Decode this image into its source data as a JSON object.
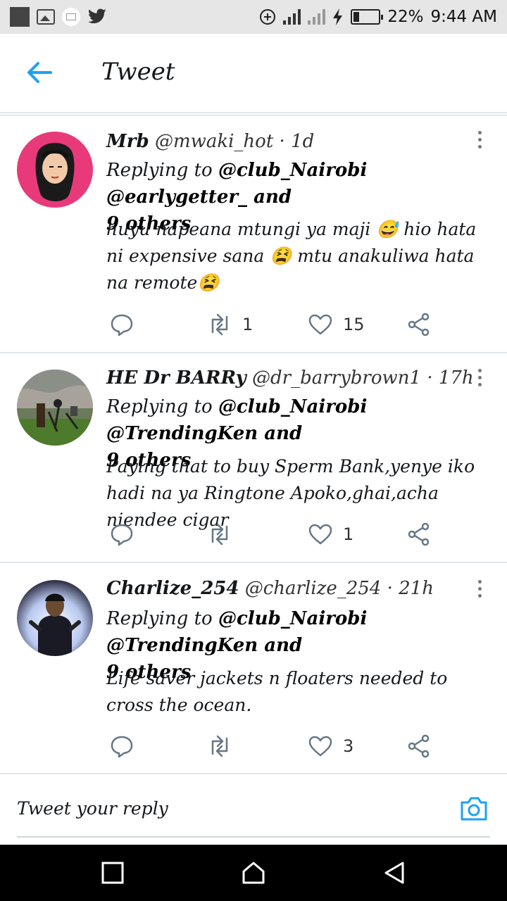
{
  "status_bar": {
    "battery": "22%",
    "time": "9:44 AM"
  },
  "header": {
    "title": "Tweet",
    "back_icon": "arrow-left-icon"
  },
  "tweets": [
    {
      "name": "Mrb",
      "handle": "@mwaki_hot",
      "time": "1d",
      "replying_prefix": "Replying to",
      "replying_to": "@club_Nairobi @earlygetter_ and",
      "replying_more": "9 others",
      "text": "huyu napeana mtungi ya maji 😅 hio hata ni expensive sana 😫 mtu anakuliwa hata na remote😫",
      "retweets": "1",
      "likes": "15"
    },
    {
      "name": "HE Dr BARRy",
      "handle": "@dr_barrybrown1",
      "time": "17h",
      "replying_prefix": "Replying to",
      "replying_to": "@club_Nairobi @TrendingKen and",
      "replying_more": "9 others",
      "text": "Paying that to buy Sperm Bank,yenye iko hadi na ya Ringtone Apoko,ghai,acha niendee cigar",
      "retweets": "",
      "likes": "1"
    },
    {
      "name": "Charlize_254",
      "handle": "@charlize_254",
      "time": "21h",
      "replying_prefix": "Replying to",
      "replying_to": "@club_Nairobi @TrendingKen and",
      "replying_more": "9 others",
      "text": "Life saver jackets n floaters needed to cross the ocean.",
      "retweets": "",
      "likes": "3"
    }
  ],
  "reply_box": {
    "placeholder": "Tweet your reply",
    "icon": "camera-icon"
  },
  "colors": {
    "accent": "#1da1f2",
    "icon_gray": "#657786",
    "divider": "#e1e8ed"
  }
}
